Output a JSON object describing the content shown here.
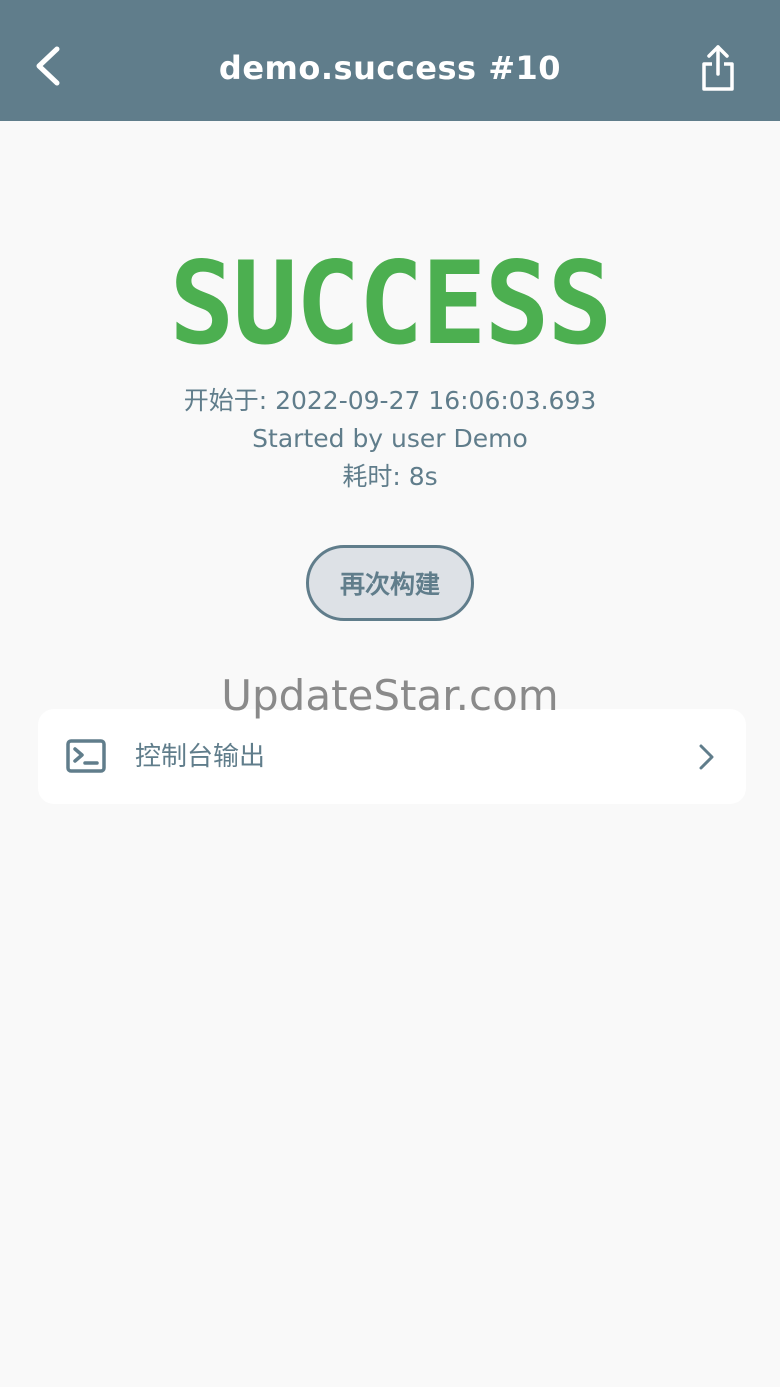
{
  "header": {
    "title": "demo.success #10",
    "back_icon": "chevron-left-icon",
    "share_icon": "share-icon"
  },
  "build": {
    "status": "SUCCESS",
    "status_color": "#4caf50",
    "started_at": "开始于: 2022-09-27 16:06:03.693",
    "started_by": "Started by user Demo",
    "duration": "耗时: 8s",
    "rebuild_label": "再次构建"
  },
  "watermark": "UpdateStar.com",
  "console": {
    "label": "控制台输出",
    "icon": "terminal-icon",
    "chevron_icon": "chevron-right-icon"
  },
  "colors": {
    "header_bg": "#607d8b",
    "accent": "#607d8b",
    "page_bg": "#f9f9f9"
  }
}
